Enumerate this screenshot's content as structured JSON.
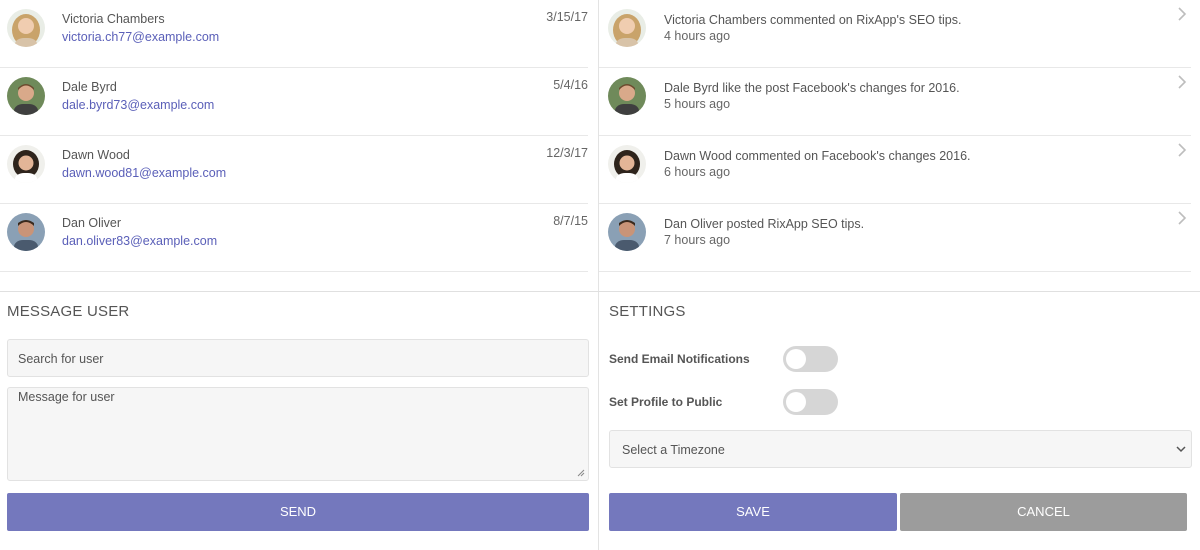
{
  "members": [
    {
      "name": "Victoria Chambers",
      "email": "victoria.ch77@example.com",
      "date": "3/15/17"
    },
    {
      "name": "Dale Byrd",
      "email": "dale.byrd73@example.com",
      "date": "5/4/16"
    },
    {
      "name": "Dawn Wood",
      "email": "dawn.wood81@example.com",
      "date": "12/3/17"
    },
    {
      "name": "Dan Oliver",
      "email": "dan.oliver83@example.com",
      "date": "8/7/15"
    }
  ],
  "activity": [
    {
      "text": "Victoria Chambers commented on RixApp's SEO tips.",
      "time": "4 hours ago"
    },
    {
      "text": "Dale Byrd like the post Facebook's changes for 2016.",
      "time": "5 hours ago"
    },
    {
      "text": "Dawn Wood commented on Facebook's changes 2016.",
      "time": "6 hours ago"
    },
    {
      "text": "Dan Oliver posted RixApp SEO tips.",
      "time": "7 hours ago"
    }
  ],
  "message_user": {
    "title": "MESSAGE USER",
    "search_placeholder": "Search for user",
    "message_placeholder": "Message for user",
    "send_label": "SEND"
  },
  "settings": {
    "title": "SETTINGS",
    "email_notifications_label": "Send Email Notifications",
    "email_notifications_on": false,
    "public_profile_label": "Set Profile to Public",
    "public_profile_on": false,
    "timezone_placeholder": "Select a Timezone",
    "save_label": "SAVE",
    "cancel_label": "CANCEL"
  },
  "colors": {
    "accent": "#7478bd",
    "link": "#5a5fb8",
    "cancel": "#9c9c9c"
  }
}
